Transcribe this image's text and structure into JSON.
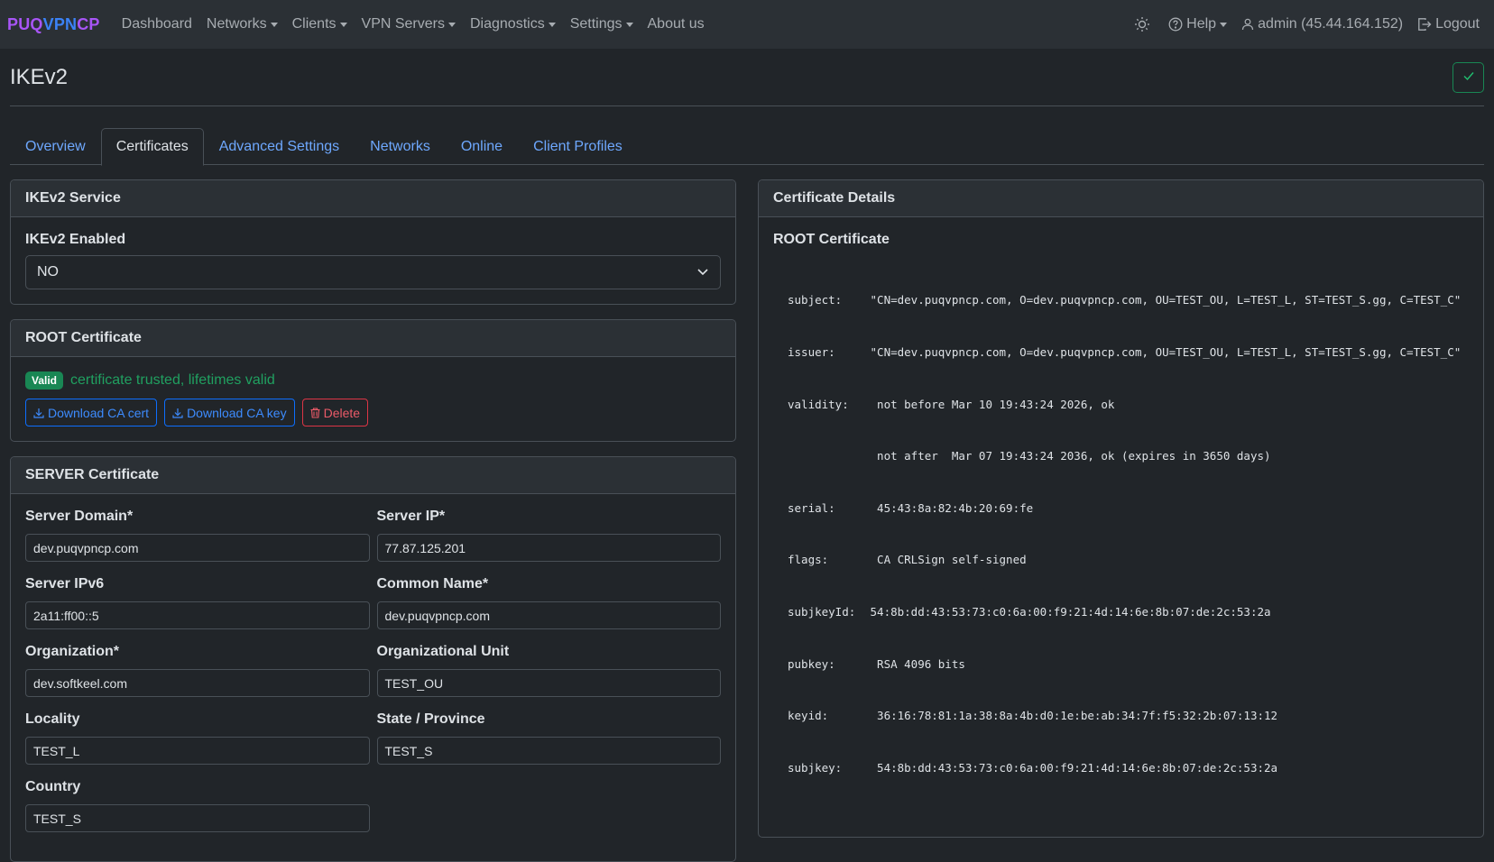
{
  "navbar": {
    "brand": {
      "part1": "PUQ",
      "part2": "VPN",
      "part3": "CP"
    },
    "items": [
      "Dashboard",
      "Networks",
      "Clients",
      "VPN Servers",
      "Diagnostics",
      "Settings",
      "About us"
    ],
    "help": "Help",
    "user": "admin (45.44.164.152)",
    "logout": "Logout"
  },
  "page": {
    "title": "IKEv2"
  },
  "tabs": [
    "Overview",
    "Certificates",
    "Advanced Settings",
    "Networks",
    "Online",
    "Client Profiles"
  ],
  "service": {
    "header": "IKEv2 Service",
    "label": "IKEv2 Enabled",
    "value": "NO"
  },
  "root": {
    "header": "ROOT Certificate",
    "badge": "Valid",
    "status": "certificate trusted, lifetimes valid",
    "download_cert": "Download CA cert",
    "download_key": "Download CA key",
    "delete": "Delete"
  },
  "server": {
    "header": "SERVER Certificate",
    "fields": {
      "domain": {
        "label": "Server Domain*",
        "value": "dev.puqvpncp.com"
      },
      "ip": {
        "label": "Server IP*",
        "value": "77.87.125.201"
      },
      "ipv6": {
        "label": "Server IPv6",
        "value": "2a11:ff00::5"
      },
      "cn": {
        "label": "Common Name*",
        "value": "dev.puqvpncp.com"
      },
      "org": {
        "label": "Organization*",
        "value": "dev.softkeel.com"
      },
      "ou": {
        "label": "Organizational Unit",
        "value": "TEST_OU"
      },
      "locality": {
        "label": "Locality",
        "value": "TEST_L"
      },
      "state": {
        "label": "State / Province",
        "value": "TEST_S"
      },
      "country": {
        "label": "Country",
        "value": "TEST_S"
      }
    }
  },
  "details": {
    "header": "Certificate Details",
    "title": "ROOT Certificate",
    "lines": [
      {
        "key": "subject:",
        "value": " \"CN=dev.puqvpncp.com, O=dev.puqvpncp.com, OU=TEST_OU, L=TEST_L, ST=TEST_S.gg, C=TEST_C\""
      },
      {
        "key": "issuer:",
        "value": " \"CN=dev.puqvpncp.com, O=dev.puqvpncp.com, OU=TEST_OU, L=TEST_L, ST=TEST_S.gg, C=TEST_C\""
      },
      {
        "key": "validity:",
        "value": "  not before Mar 10 19:43:24 2026, ok"
      },
      {
        "key": "",
        "value": "  not after  Mar 07 19:43:24 2036, ok (expires in 3650 days)"
      },
      {
        "key": "serial:",
        "value": "  45:43:8a:82:4b:20:69:fe"
      },
      {
        "key": "flags:",
        "value": "  CA CRLSign self-signed"
      },
      {
        "key": "subjkeyId:",
        "value": " 54:8b:dd:43:53:73:c0:6a:00:f9:21:4d:14:6e:8b:07:de:2c:53:2a"
      },
      {
        "key": "pubkey:",
        "value": "  RSA 4096 bits"
      },
      {
        "key": "keyid:",
        "value": "  36:16:78:81:1a:38:8a:4b:d0:1e:be:ab:34:7f:f5:32:2b:07:13:12"
      },
      {
        "key": "subjkey:",
        "value": "  54:8b:dd:43:53:73:c0:6a:00:f9:21:4d:14:6e:8b:07:de:2c:53:2a"
      }
    ]
  },
  "colors": {
    "accent": "#6ea8fe",
    "success": "#198754",
    "danger": "#dc3545",
    "bg": "#212529"
  }
}
